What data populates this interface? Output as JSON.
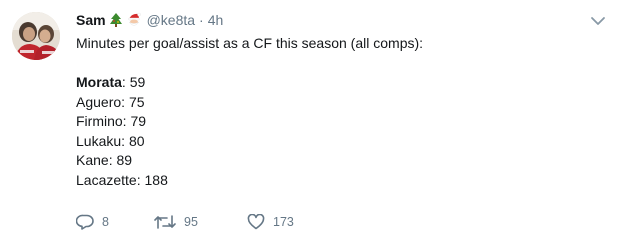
{
  "tweet": {
    "author_name": "Sam",
    "handle": "@ke8ta",
    "separator": "·",
    "time": "4h",
    "intro": "Minutes per goal/assist as a CF this season (all comps):",
    "stats": [
      {
        "player": "Morata",
        "value": "59",
        "bold": true
      },
      {
        "player": "Aguero",
        "value": "75",
        "bold": false
      },
      {
        "player": "Firmino",
        "value": "79",
        "bold": false
      },
      {
        "player": "Lukaku",
        "value": "80",
        "bold": false
      },
      {
        "player": "Kane",
        "value": "89",
        "bold": false
      },
      {
        "player": "Lacazette",
        "value": "188",
        "bold": false
      }
    ],
    "replies": "8",
    "retweets": "95",
    "likes": "173"
  },
  "icons": {
    "name_emoji_1": "christmas-tree-icon",
    "name_emoji_2": "santa-icon",
    "reply": "reply-icon",
    "retweet": "retweet-icon",
    "like": "heart-icon",
    "menu": "chevron-down-icon"
  },
  "colors": {
    "text": "#14171a",
    "secondary": "#657786",
    "background": "#ffffff"
  }
}
